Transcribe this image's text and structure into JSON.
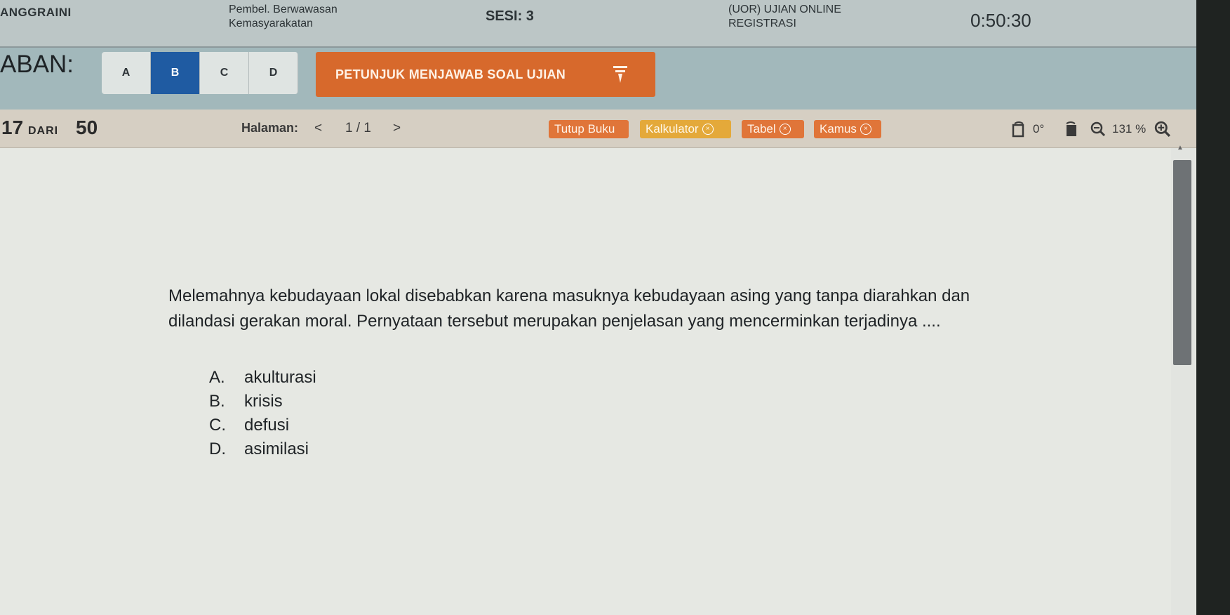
{
  "header": {
    "name": "ANGGRAINI",
    "subject_line1": "Pembel. Berwawasan",
    "subject_line2": "Kemasyarakatan",
    "session": "SESI: 3",
    "exam_line1": "(UOR) UJIAN ONLINE",
    "exam_line2": "REGISTRASI",
    "timer": "0:50:30"
  },
  "answer_bar": {
    "label": "ABAN:",
    "options": [
      "A",
      "B",
      "C",
      "D"
    ],
    "selected": "B",
    "instructions_button": "PETUNJUK MENJAWAB SOAL UJIAN"
  },
  "nav": {
    "question_number": "17",
    "of_label": "DARI",
    "total_questions": "50",
    "page_label": "Halaman:",
    "page_prev": "<",
    "page_value": "1 / 1",
    "page_next": ">",
    "tools": {
      "tutup_buku": "Tutup Buku",
      "kalkulator": "Kalkulator",
      "tabel": "Tabel",
      "kamus": "Kamus",
      "close_symbol": "×"
    },
    "rotation": "0°",
    "zoom": "131 %"
  },
  "question": {
    "text": "Melemahnya kebudayaan lokal disebabkan karena masuknya kebudayaan asing yang tanpa diarahkan dan dilandasi gerakan moral. Pernyataan tersebut merupakan penjelasan yang mencerminkan terjadinya ....",
    "choices": [
      {
        "letter": "A.",
        "text": "akulturasi"
      },
      {
        "letter": "B.",
        "text": "krisis"
      },
      {
        "letter": "C.",
        "text": "defusi"
      },
      {
        "letter": "D.",
        "text": "asimilasi"
      }
    ]
  },
  "colors": {
    "selected_option": "#1f5ba2",
    "orange_button": "#e07539",
    "calculator_button": "#e4a93a",
    "instructions_button": "#d7692c"
  },
  "icons": [
    "rotate-left-icon",
    "rotate-right-icon",
    "zoom-out-icon",
    "zoom-in-icon",
    "pencil-icon",
    "close-icon"
  ]
}
